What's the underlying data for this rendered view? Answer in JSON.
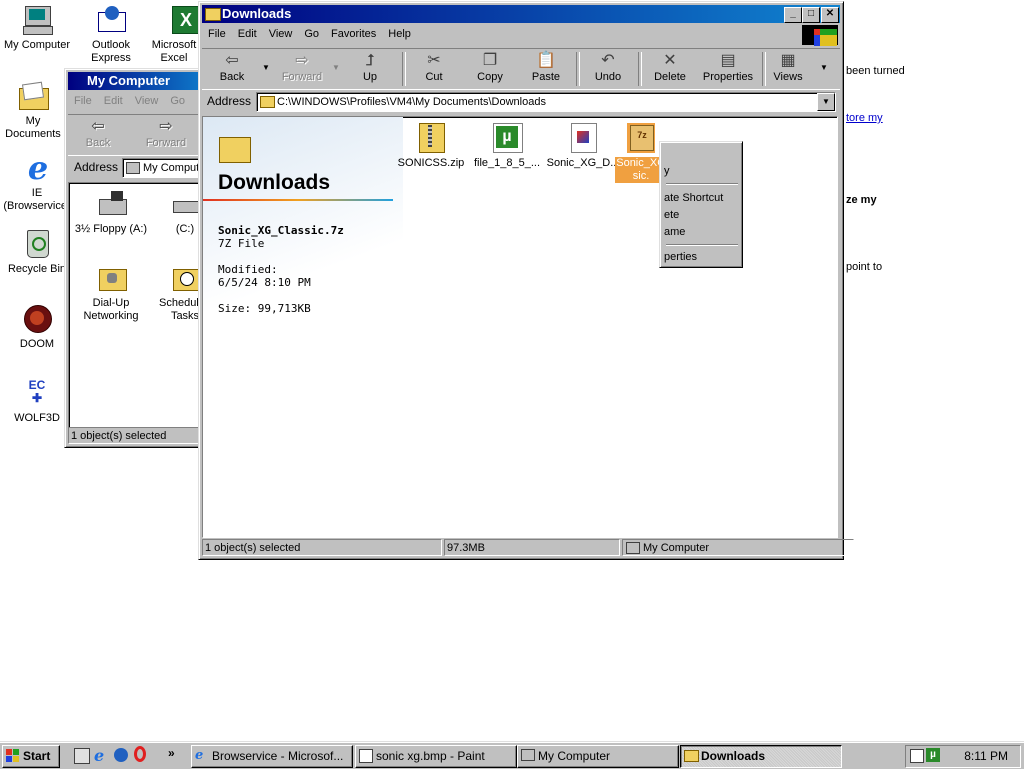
{
  "desktop": {
    "icons": [
      {
        "label": "My Computer",
        "icon": "my-computer-icon"
      },
      {
        "label": "Outlook Express",
        "icon": "outlook-express-icon"
      },
      {
        "label": "Microsoft Excel",
        "icon": "excel-icon"
      },
      {
        "label": "My Documents",
        "icon": "my-documents-icon"
      },
      {
        "label": "IE (Browservice)",
        "icon": "ie-icon"
      },
      {
        "label": "Recycle Bin",
        "icon": "recycle-bin-icon"
      },
      {
        "label": "DOOM",
        "icon": "doom-icon"
      },
      {
        "label": "WOLF3D",
        "icon": "wolf3d-icon"
      }
    ],
    "background_text": {
      "line1": "been turned",
      "link1": "tore my",
      "bold1": "ze my",
      "line2": "point to"
    }
  },
  "my_computer_window": {
    "title": "My Computer",
    "menu": [
      "File",
      "Edit",
      "View",
      "Go"
    ],
    "toolbar": {
      "back": "Back",
      "forward": "Forward"
    },
    "address_label": "Address",
    "address_value": "My Computer",
    "items": [
      {
        "label": "3½ Floppy (A:)",
        "icon": "floppy-drive-icon"
      },
      {
        "label": "(C:)",
        "icon": "hard-drive-icon"
      },
      {
        "label": "Dial-Up Networking",
        "icon": "dialup-networking-icon"
      },
      {
        "label": "Scheduled Tasks",
        "icon": "scheduled-tasks-icon"
      }
    ],
    "status": "1 object(s) selected"
  },
  "downloads_window": {
    "title": "Downloads",
    "menu": [
      "File",
      "Edit",
      "View",
      "Go",
      "Favorites",
      "Help"
    ],
    "toolbar": {
      "back": "Back",
      "forward": "Forward",
      "up": "Up",
      "cut": "Cut",
      "copy": "Copy",
      "paste": "Paste",
      "undo": "Undo",
      "delete": "Delete",
      "properties": "Properties",
      "views": "Views"
    },
    "address_label": "Address",
    "address_value": "C:\\WINDOWS\\Profiles\\VM4\\My Documents\\Downloads",
    "webview": {
      "folder_title": "Downloads",
      "selected_name": "Sonic_XG_Classic.7z",
      "selected_type": "7Z File",
      "modified_label": "Modified:",
      "modified_value": "6/5/24 8:10 PM",
      "size_label": "Size: 99,713KB"
    },
    "files": [
      {
        "label": "SONICSS.zip",
        "icon": "zip-file-icon"
      },
      {
        "label": "file_1_8_5_...",
        "icon": "utorrent-file-icon"
      },
      {
        "label": "Sonic_XG_D...",
        "icon": "winamp-file-icon"
      },
      {
        "label": "Sonic_XG_Classic.7z",
        "label_line1": "Sonic_XG",
        "label_line2": "sic.",
        "icon": "7z-file-icon"
      }
    ],
    "context_menu": [
      "y",
      "ate Shortcut",
      "ete",
      "ame",
      "perties"
    ],
    "status": {
      "selected": "1 object(s) selected",
      "size": "97.3MB",
      "zone": "My Computer"
    }
  },
  "taskbar": {
    "start": "Start",
    "buttons": [
      {
        "label": "Browservice - Microsof...",
        "icon": "ie-icon"
      },
      {
        "label": "sonic xg.bmp - Paint",
        "icon": "paint-icon"
      },
      {
        "label": "My Computer",
        "icon": "my-computer-icon"
      },
      {
        "label": "Downloads",
        "icon": "folder-icon"
      }
    ],
    "quicklaunch_more": "»",
    "clock": "8:11 PM"
  },
  "colors": {
    "title_active": "#000080",
    "title_inactive": "#808080",
    "face": "#c0c0c0",
    "selection": "#f0a040"
  }
}
